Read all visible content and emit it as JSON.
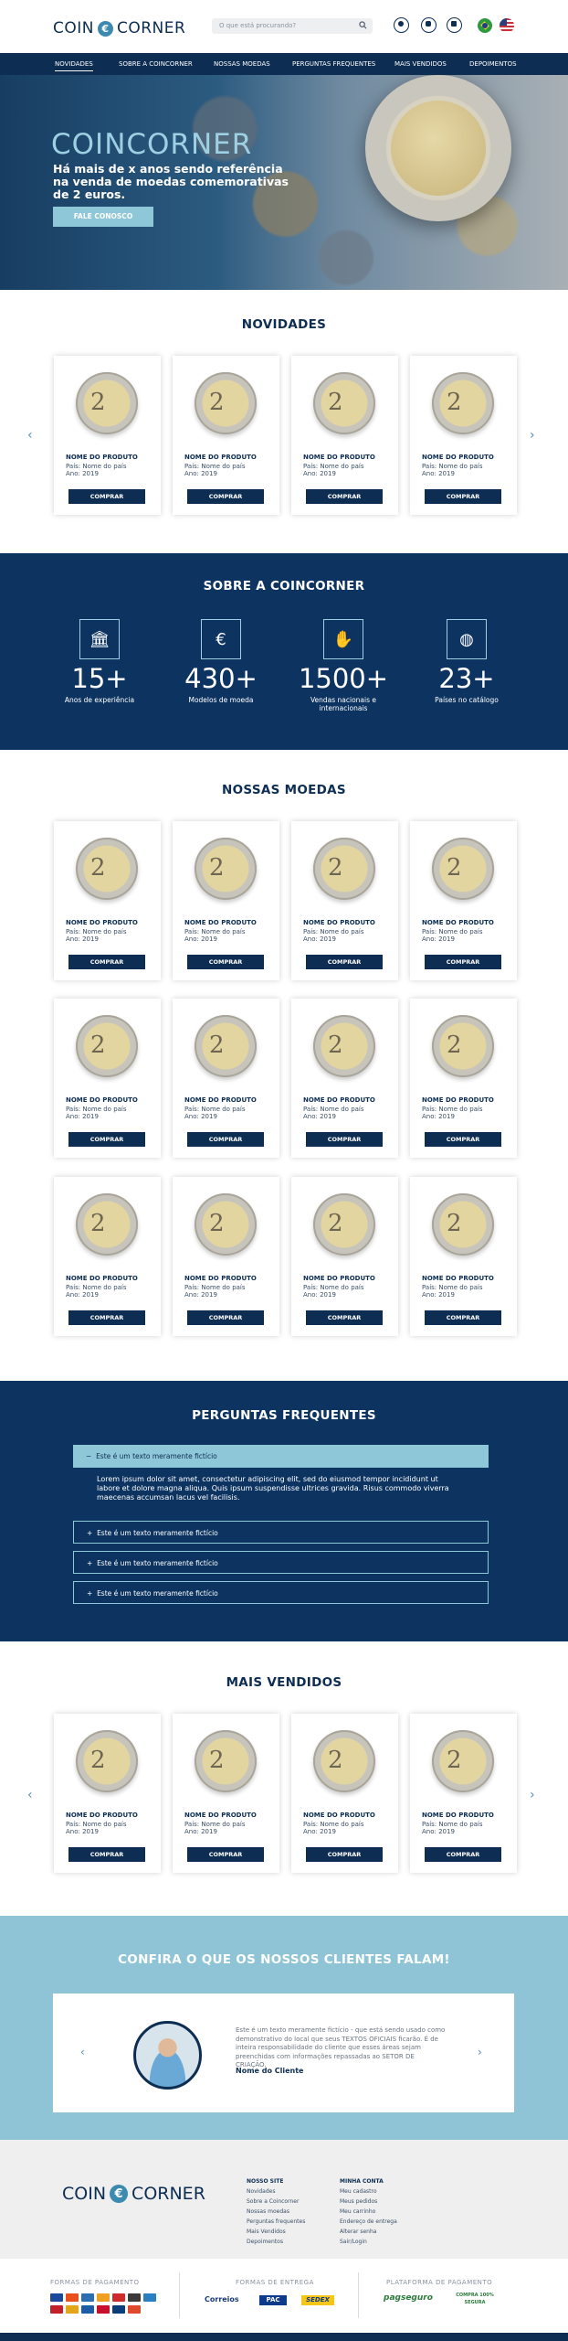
{
  "header": {
    "logo_left": "COIN",
    "logo_mid": "€",
    "logo_right": "CORNER",
    "search_placeholder": "O que está procurando?"
  },
  "nav": [
    "NOVIDADES",
    "SOBRE A COINCORNER",
    "NOSSAS MOEDAS",
    "PERGUNTAS FREQUENTES",
    "MAIS VENDIDOS",
    "DEPOIMENTOS"
  ],
  "hero": {
    "title": "COINCORNER",
    "subtitle": "Há mais de x anos sendo referência na venda de moedas comemorativas de 2 euros.",
    "cta": "FALE CONOSCO"
  },
  "product": {
    "coin_glyph": "2",
    "name": "NOME DO PRODUTO",
    "country": "País: Nome do país",
    "year": "Ano: 2019",
    "buy": "COMPRAR"
  },
  "sections": {
    "novidades": "NOVIDADES",
    "about": "SOBRE A COINCORNER",
    "moedas": "NOSSAS MOEDAS",
    "faq": "PERGUNTAS FREQUENTES",
    "mais_vendidos": "MAIS VENDIDOS",
    "testimonials": "CONFIRA O QUE OS NOSSOS CLIENTES FALAM!"
  },
  "stats": [
    {
      "icon": "bank-icon",
      "glyph": "🏛",
      "num": "15+",
      "label": "Anos de experiência"
    },
    {
      "icon": "euro-icon",
      "glyph": "€",
      "num": "430+",
      "label": "Modelos de moeda"
    },
    {
      "icon": "handshake-icon",
      "glyph": "✋",
      "num": "1500+",
      "label": "Vendas nacionais e internacionais"
    },
    {
      "icon": "globe-icon",
      "glyph": "◍",
      "num": "23+",
      "label": "Países no catálogo"
    }
  ],
  "faq": {
    "items": [
      "Este é um texto meramente fictício",
      "Este é um texto meramente fictício",
      "Este é um texto meramente fictício",
      "Este é um texto meramente fictício"
    ],
    "answer": "Lorem ipsum dolor sit amet, consectetur adipiscing elit, sed do eiusmod tempor incididunt ut labore et dolore magna aliqua. Quis ipsum suspendisse ultrices gravida. Risus commodo viverra maecenas accumsan lacus vel facilisis."
  },
  "testimonial": {
    "text": "Este é um texto meramente fictício - que está sendo usado como demonstrativo do local que seus TEXTOS OFICIAIS ficarão. É de inteira responsabilidade do cliente que esses áreas sejam preenchidas com informações repassadas ao SETOR DE CRIAÇÃO.",
    "name": "Nome do Cliente"
  },
  "footer": {
    "logo_left": "COIN",
    "logo_mid": "€",
    "logo_right": "CORNER",
    "col1_title": "NOSSO SITE",
    "col1": [
      "Novidades",
      "Sobre a Coincorner",
      "Nossas moedas",
      "Perguntas frequentes",
      "Mais Vendidos",
      "Depoimentos"
    ],
    "col2_title": "MINHA CONTA",
    "col2": [
      "Meu cadastro",
      "Meus pedidos",
      "Meu carrinho",
      "Endereço de entrega",
      "Alterar senha",
      "Sair/Login"
    ],
    "pay_title": "FORMAS DE PAGAMENTO",
    "ship_title": "FORMAS DE ENTREGA",
    "platform_title": "PLATAFORMA DE PAGAMENTO",
    "ship_logos": [
      "Correios",
      "PAC",
      "SEDEX"
    ],
    "platform_logos": [
      "pagseguro",
      "COMPRA 100% SEGURA"
    ]
  }
}
